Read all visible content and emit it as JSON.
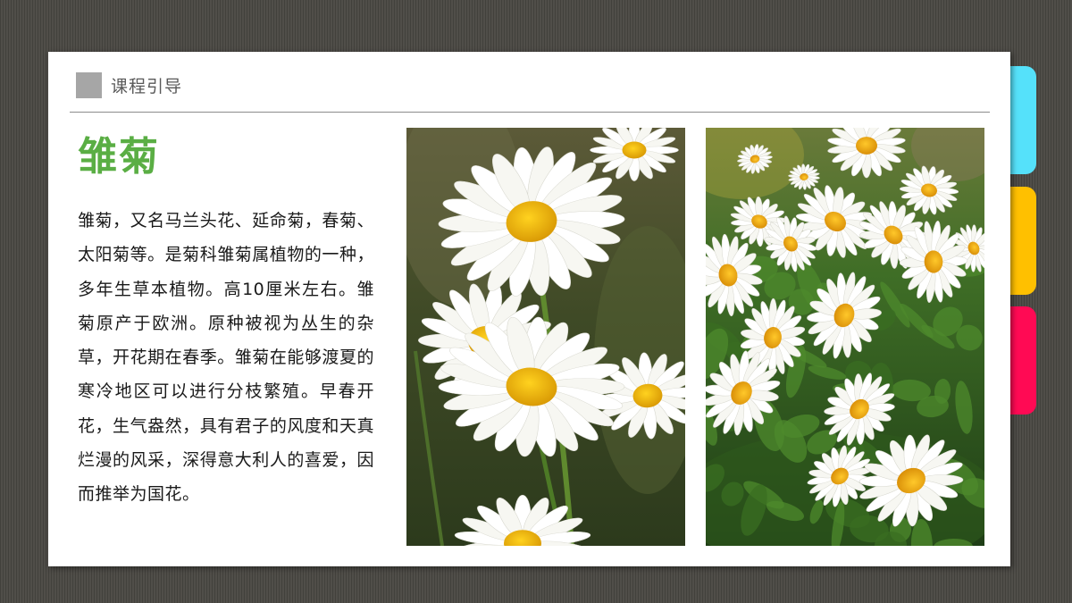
{
  "header": {
    "title": "课程引导"
  },
  "main": {
    "heading": "雏菊",
    "paragraph": "雏菊，又名马兰头花、延命菊，春菊、太阳菊等。是菊科雏菊属植物的一种，多年生草本植物。高10厘米左右。雏菊原产于欧洲。原种被视为丛生的杂草，开花期在春季。雏菊在能够渡夏的寒冷地区可以进行分枝繁殖。早春开花，生气盎然，具有君子的风度和天真烂漫的风采，深得意大利人的喜爱，因而推举为国花。"
  },
  "side_tabs": [
    {
      "color": "#55e1fa"
    },
    {
      "color": "#ffc000"
    },
    {
      "color": "#ff0a54"
    }
  ],
  "colors": {
    "heading": "#5aae44",
    "petal": "#ffffff",
    "flower_center": "#f3b50e",
    "foliage_dark": "#2f4a1f",
    "foliage_light": "#4e8a2c"
  },
  "photos": [
    {
      "name": "daisy-closeup-photo"
    },
    {
      "name": "daisy-field-photo"
    }
  ]
}
